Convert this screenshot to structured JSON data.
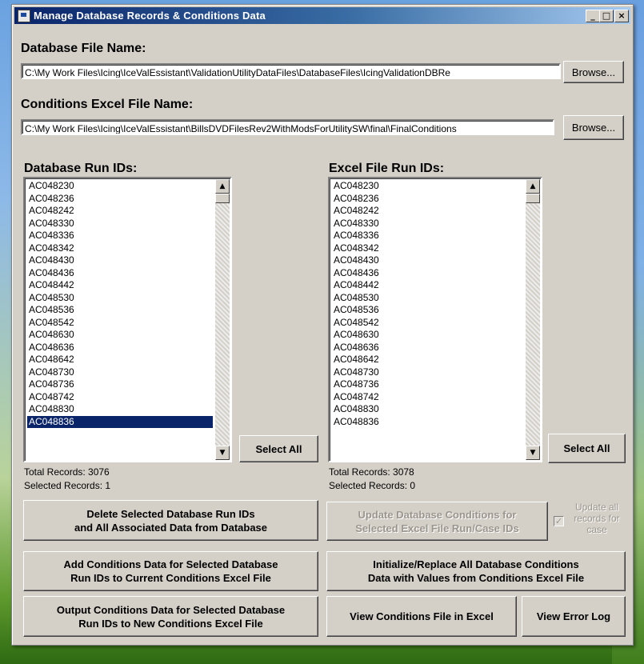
{
  "window": {
    "title": "Manage Database Records & Conditions Data",
    "minimize_glyph": "_",
    "maximize_glyph": "□",
    "close_glyph": "×"
  },
  "database_file": {
    "label": "Database File Name:",
    "value": "C:\\My Work Files\\Icing\\IceValEssistant\\ValidationUtilityDataFiles\\DatabaseFiles\\IcingValidationDBRe",
    "browse_label": "Browse..."
  },
  "conditions_file": {
    "label": "Conditions Excel File Name:",
    "value": "C:\\My Work Files\\Icing\\IceValEssistant\\BillsDVDFilesRev2WithModsForUtilitySW\\final\\FinalConditions",
    "browse_label": "Browse..."
  },
  "db_list": {
    "label": "Database Run IDs:",
    "items": [
      "AC048230",
      "AC048236",
      "AC048242",
      "AC048330",
      "AC048336",
      "AC048342",
      "AC048430",
      "AC048436",
      "AC048442",
      "AC048530",
      "AC048536",
      "AC048542",
      "AC048630",
      "AC048636",
      "AC048642",
      "AC048730",
      "AC048736",
      "AC048742",
      "AC048830",
      "AC048836"
    ],
    "selected_item": "AC048836",
    "select_all_label": "Select All",
    "total_records": "Total Records:  3076",
    "selected_records": "Selected Records:  1"
  },
  "excel_list": {
    "label": "Excel File Run IDs:",
    "items": [
      "AC048230",
      "AC048236",
      "AC048242",
      "AC048330",
      "AC048336",
      "AC048342",
      "AC048430",
      "AC048436",
      "AC048442",
      "AC048530",
      "AC048536",
      "AC048542",
      "AC048630",
      "AC048636",
      "AC048642",
      "AC048730",
      "AC048736",
      "AC048742",
      "AC048830",
      "AC048836"
    ],
    "select_all_label": "Select All",
    "total_records": "Total Records:  3078",
    "selected_records": "Selected Records:  0"
  },
  "buttons": {
    "delete_selected": "Delete Selected Database Run IDs\nand All Associated Data from Database",
    "update_conditions": "Update Database Conditions for\nSelected Excel File Run/Case IDs",
    "update_all_checkbox_label": "Update all\nrecords for\ncase",
    "add_conditions": "Add Conditions Data for Selected Database\nRun IDs to Current Conditions Excel File",
    "initialize_replace": "Initialize/Replace All Database Conditions\nData with Values from Conditions Excel File",
    "output_conditions": "Output Conditions Data for Selected Database\nRun IDs to New Conditions Excel File",
    "view_conditions_file": "View Conditions File in Excel",
    "view_error_log": "View Error Log"
  },
  "icons": {
    "app": "database-icon",
    "scroll_up": "▲",
    "scroll_down": "▼",
    "check": "✓"
  }
}
